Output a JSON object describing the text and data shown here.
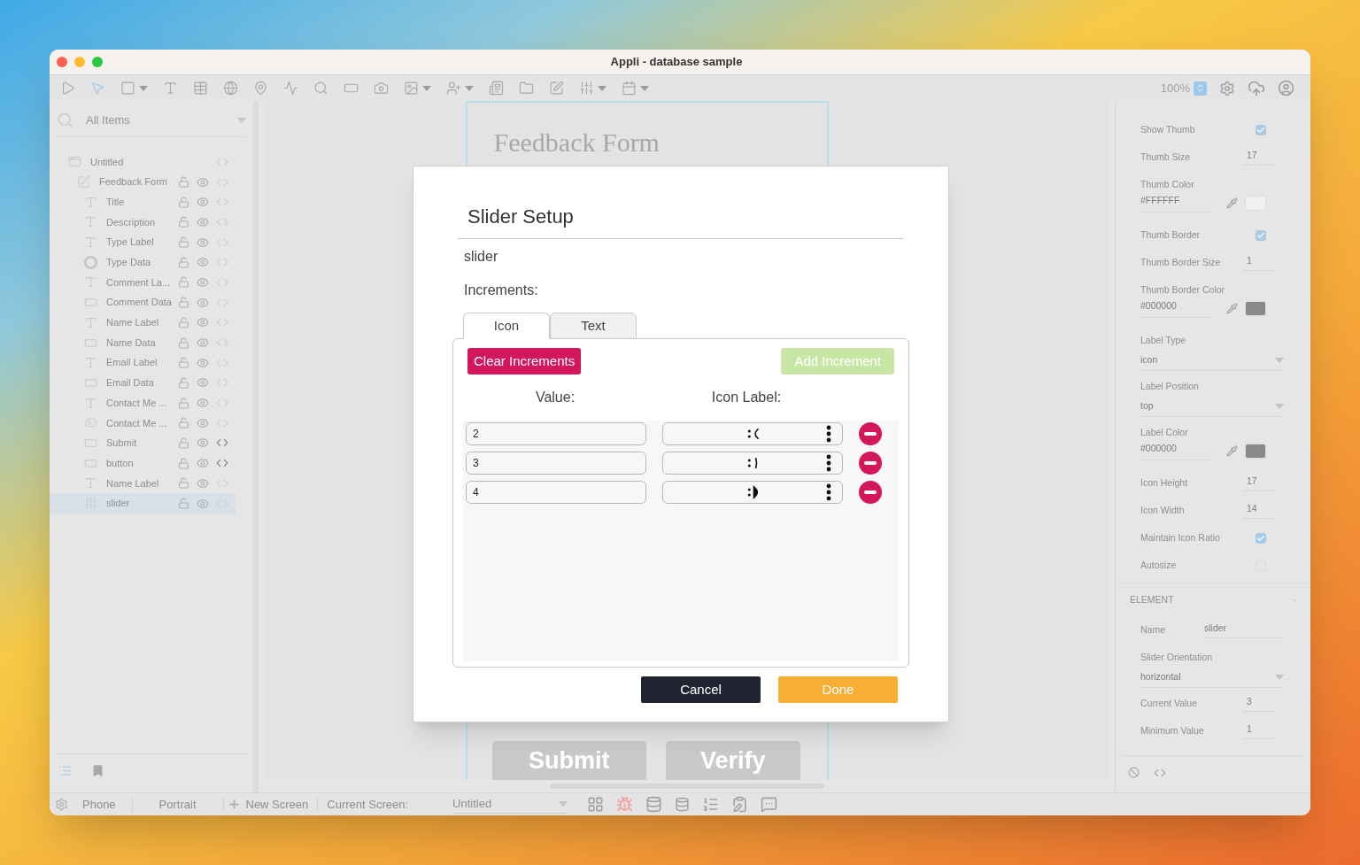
{
  "window": {
    "title": "Appli - database sample"
  },
  "toolbar": {
    "zoom": "100%"
  },
  "sidebar": {
    "search_placeholder": "All Items",
    "tree": [
      {
        "label": "Untitled",
        "kind": "screen",
        "script": false,
        "selected": false,
        "children": [
          {
            "label": "Feedback Form",
            "kind": "form",
            "script": false,
            "selected": false,
            "children": [
              {
                "label": "Title",
                "kind": "text",
                "script": false,
                "selected": false
              },
              {
                "label": "Description",
                "kind": "text",
                "script": false,
                "selected": false
              },
              {
                "label": "Type Label",
                "kind": "text",
                "script": false,
                "selected": false
              },
              {
                "label": "Type Data",
                "kind": "radio",
                "script": false,
                "selected": false
              },
              {
                "label": "Comment La...",
                "kind": "text",
                "script": false,
                "selected": false
              },
              {
                "label": "Comment Data",
                "kind": "field",
                "script": false,
                "selected": false
              },
              {
                "label": "Name Label",
                "kind": "text",
                "script": false,
                "selected": false
              },
              {
                "label": "Name Data",
                "kind": "field",
                "script": false,
                "selected": false
              },
              {
                "label": "Email Label",
                "kind": "text",
                "script": false,
                "selected": false
              },
              {
                "label": "Email Data",
                "kind": "field",
                "script": false,
                "selected": false
              },
              {
                "label": "Contact Me ...",
                "kind": "text",
                "script": false,
                "selected": false
              },
              {
                "label": "Contact Me ...",
                "kind": "toggle",
                "script": false,
                "selected": false
              },
              {
                "label": "Submit",
                "kind": "button",
                "script": true,
                "selected": false
              },
              {
                "label": "button",
                "kind": "button",
                "script": true,
                "selected": false
              },
              {
                "label": "Name Label",
                "kind": "text",
                "script": false,
                "selected": false
              },
              {
                "label": "slider",
                "kind": "slider",
                "script": false,
                "selected": true
              }
            ]
          }
        ]
      }
    ]
  },
  "canvas": {
    "title": "Feedback Form",
    "buttons": [
      "Submit",
      "Verify"
    ]
  },
  "properties": [
    {
      "kind": "check",
      "label": "Show Thumb",
      "checked": true
    },
    {
      "kind": "number",
      "label": "Thumb Size",
      "value": "17"
    },
    {
      "kind": "color",
      "label": "Thumb Color",
      "value": "#FFFFFF"
    },
    {
      "kind": "check",
      "label": "Thumb Border",
      "checked": true
    },
    {
      "kind": "number",
      "label": "Thumb Border Size",
      "value": "1"
    },
    {
      "kind": "color",
      "label": "Thumb Border Color",
      "value": "#000000"
    },
    {
      "kind": "select",
      "label": "Label Type",
      "value": "icon"
    },
    {
      "kind": "select",
      "label": "Label Position",
      "value": "top"
    },
    {
      "kind": "color",
      "label": "Label Color",
      "value": "#000000"
    },
    {
      "kind": "number",
      "label": "Icon Height",
      "value": "17"
    },
    {
      "kind": "number",
      "label": "Icon Width",
      "value": "14"
    },
    {
      "kind": "check",
      "label": "Maintain Icon Ratio",
      "checked": true
    },
    {
      "kind": "check",
      "label": "Autosize",
      "checked": false
    },
    {
      "kind": "section",
      "label": "ELEMENT"
    },
    {
      "kind": "text",
      "label": "Name",
      "value": "slider"
    },
    {
      "kind": "select",
      "label": "Slider Orientation",
      "value": "horizontal"
    },
    {
      "kind": "number",
      "label": "Current Value",
      "value": "3"
    },
    {
      "kind": "number",
      "label": "Minimum Value",
      "value": "1"
    }
  ],
  "status_bar": {
    "device": "Phone",
    "orientation": "Portrait",
    "new_screen": "New Screen",
    "current_label": "Current Screen:",
    "current_value": "Untitled"
  },
  "dialog": {
    "title": "Slider Setup",
    "name": "slider",
    "increments_label": "Increments:",
    "tabs": [
      {
        "label": "Icon",
        "selected": true
      },
      {
        "label": "Text",
        "selected": false
      }
    ],
    "clear_button": "Clear Increments",
    "add_button": "Add Increment",
    "columns": [
      "Value:",
      "Icon Label:"
    ],
    "rows": [
      {
        "value": "2",
        "kind": "sad"
      },
      {
        "value": "3",
        "kind": "neutral"
      },
      {
        "value": "4",
        "kind": "happy"
      }
    ],
    "cancel": "Cancel",
    "done": "Done"
  }
}
